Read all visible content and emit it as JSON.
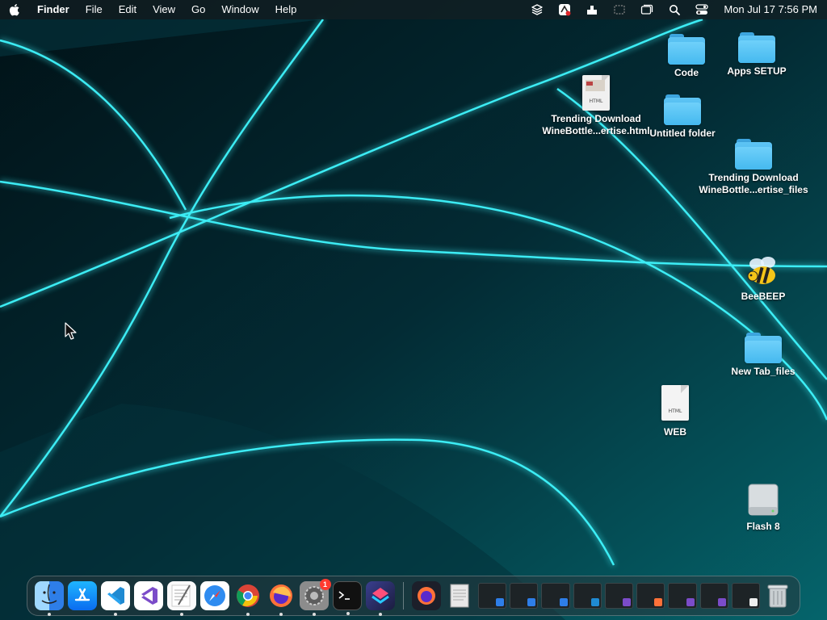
{
  "menubar": {
    "app_name": "Finder",
    "menus": [
      "File",
      "Edit",
      "View",
      "Go",
      "Window",
      "Help"
    ],
    "status_icons": [
      "layers-icon",
      "pdf-annotate-icon",
      "uplink-icon",
      "screen-record-icon",
      "window-switch-icon",
      "search-icon",
      "control-center-icon"
    ],
    "clock": "Mon Jul 17  7:56 PM"
  },
  "desktop": {
    "icons": [
      {
        "label": "Code",
        "type": "folder"
      },
      {
        "label": "Apps SETUP",
        "type": "folder"
      },
      {
        "label": "Trending Download\nWineBottle...ertise.html",
        "type": "html-document"
      },
      {
        "label": "Untitled folder",
        "type": "folder"
      },
      {
        "label": "Trending Download\nWineBottle...ertise_files",
        "type": "folder"
      },
      {
        "label": "BeeBEEP",
        "type": "app"
      },
      {
        "label": "New Tab_files",
        "type": "folder"
      },
      {
        "label": "WEB",
        "type": "html-document"
      },
      {
        "label": "Flash 8",
        "type": "drive"
      }
    ],
    "doc_tag": "HTML"
  },
  "dock": {
    "apps": [
      {
        "name": "finder-icon",
        "running": true
      },
      {
        "name": "app-store-icon",
        "running": false
      },
      {
        "name": "vscode-icon",
        "running": true
      },
      {
        "name": "visual-studio-icon",
        "running": false
      },
      {
        "name": "textedit-icon",
        "running": true
      },
      {
        "name": "safari-icon",
        "running": false
      },
      {
        "name": "chrome-icon",
        "running": true
      },
      {
        "name": "firefox-icon",
        "running": true
      },
      {
        "name": "system-settings-icon",
        "running": true,
        "badge": "1"
      },
      {
        "name": "terminal-icon",
        "running": true
      },
      {
        "name": "shortcuts-icon",
        "running": true
      }
    ],
    "minimized_count": 11,
    "colors": {
      "accent": "#00e5ff"
    }
  }
}
